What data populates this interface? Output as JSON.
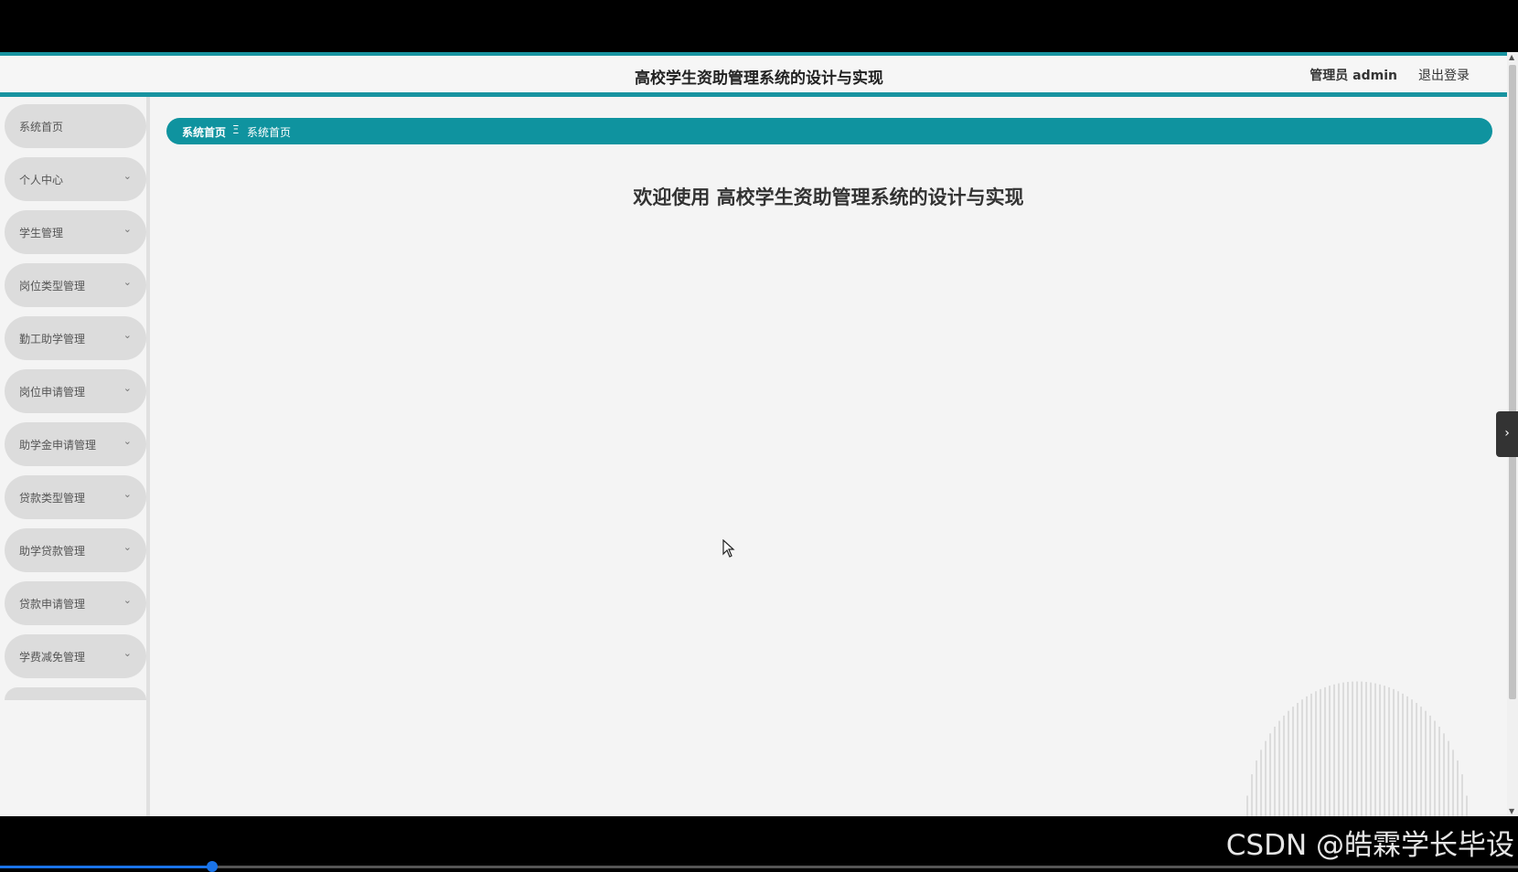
{
  "header": {
    "title": "高校学生资助管理系统的设计与实现",
    "user": "管理员 admin",
    "logout": "退出登录"
  },
  "sidebar": {
    "items": [
      {
        "label": "系统首页",
        "expandable": false
      },
      {
        "label": "个人中心",
        "expandable": true
      },
      {
        "label": "学生管理",
        "expandable": true
      },
      {
        "label": "岗位类型管理",
        "expandable": true
      },
      {
        "label": "勤工助学管理",
        "expandable": true
      },
      {
        "label": "岗位申请管理",
        "expandable": true
      },
      {
        "label": "助学金申请管理",
        "expandable": true
      },
      {
        "label": "贷款类型管理",
        "expandable": true
      },
      {
        "label": "助学贷款管理",
        "expandable": true
      },
      {
        "label": "贷款申请管理",
        "expandable": true
      },
      {
        "label": "学费减免管理",
        "expandable": true
      }
    ],
    "chevron": "⌄"
  },
  "breadcrumb": {
    "home": "系统首页",
    "separator": "Ξ",
    "current": "系统首页"
  },
  "main": {
    "welcome": "欢迎使用 高校学生资助管理系统的设计与实现"
  },
  "side_toggle": "›",
  "watermark": "CSDN @皓霖学长毕设",
  "video_progress": 0.14,
  "colors": {
    "accent": "#0f939f",
    "menu_bg": "#dcdcdc",
    "page_bg": "#f4f4f4"
  }
}
